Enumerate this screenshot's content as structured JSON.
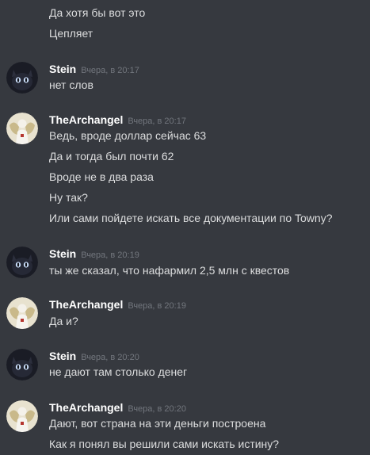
{
  "orphan_messages": [
    "Да хотя бы вот это",
    "Цепляет"
  ],
  "groups": [
    {
      "author": "Stein",
      "timestamp": "Вчера, в 20:17",
      "messages": [
        "нет слов"
      ]
    },
    {
      "author": "TheArchangel",
      "timestamp": "Вчера, в 20:17",
      "messages": [
        "Ведь, вроде доллар сейчас 63",
        "Да и тогда был почти 62",
        "Вроде не в два раза",
        "Ну так?",
        "Или сами пойдете искать все документации по Towny?"
      ]
    },
    {
      "author": "Stein",
      "timestamp": "Вчера, в 20:19",
      "messages": [
        "ты же сказал, что нафармил 2,5 млн с квестов"
      ]
    },
    {
      "author": "TheArchangel",
      "timestamp": "Вчера, в 20:19",
      "messages": [
        "Да и?"
      ]
    },
    {
      "author": "Stein",
      "timestamp": "Вчера, в 20:20",
      "messages": [
        "не дают там столько денег"
      ]
    },
    {
      "author": "TheArchangel",
      "timestamp": "Вчера, в 20:20",
      "messages": [
        "Дают, вот страна на эти деньги построена",
        "Как я понял вы решили сами искать истину?"
      ]
    }
  ],
  "colors": {
    "background": "#36393f",
    "username": "#ffffff",
    "message_text": "#dcddde",
    "timestamp": "#72767d"
  },
  "avatars": {
    "Stein": "dark-cat-avatar-icon",
    "TheArchangel": "angel-avatar-icon"
  }
}
